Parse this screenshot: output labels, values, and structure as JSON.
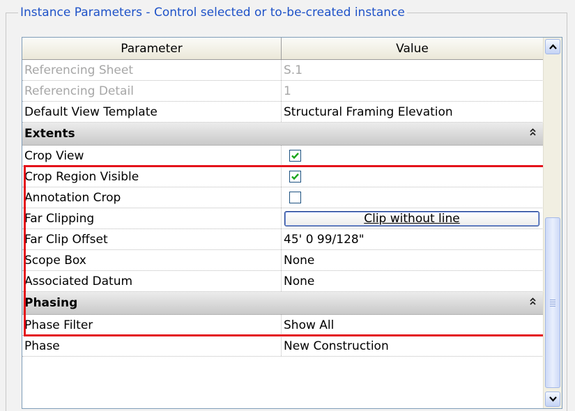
{
  "panel": {
    "title": "Instance Parameters - Control selected or to-be-created instance"
  },
  "grid": {
    "headers": {
      "parameter": "Parameter",
      "value": "Value"
    },
    "top_rows": [
      {
        "name": "Referencing Sheet",
        "value": "S.1",
        "disabled": true
      },
      {
        "name": "Referencing Detail",
        "value": "1",
        "disabled": true
      },
      {
        "name": "Default View Template",
        "value": "Structural Framing Elevation",
        "disabled": false
      }
    ],
    "groups": [
      {
        "label": "Extents",
        "highlighted": true,
        "rows": [
          {
            "name": "Crop View",
            "type": "checkbox",
            "checked": true
          },
          {
            "name": "Crop Region Visible",
            "type": "checkbox",
            "checked": true
          },
          {
            "name": "Annotation Crop",
            "type": "checkbox",
            "checked": false
          },
          {
            "name": "Far Clipping",
            "type": "dropdown",
            "value": "Clip without line"
          },
          {
            "name": "Far Clip Offset",
            "type": "text",
            "value": "45'  0 99/128\""
          },
          {
            "name": "Scope Box",
            "type": "text",
            "value": "None"
          },
          {
            "name": "Associated Datum",
            "type": "text",
            "value": "None"
          }
        ]
      },
      {
        "label": "Phasing",
        "highlighted": false,
        "rows": [
          {
            "name": "Phase Filter",
            "type": "text",
            "value": "Show All"
          },
          {
            "name": "Phase",
            "type": "text",
            "value": "New Construction"
          }
        ]
      }
    ]
  },
  "icons": {
    "collapse": "double-chevron-up-icon",
    "scroll_up": "chevron-up-icon",
    "scroll_down": "chevron-down-icon",
    "check": "check-icon"
  },
  "colors": {
    "title": "#1e52c8",
    "highlight": "#e4111a",
    "check": "#1aa51a"
  }
}
